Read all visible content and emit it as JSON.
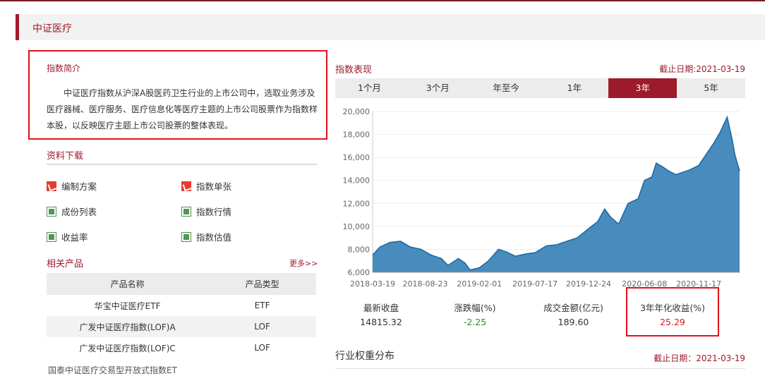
{
  "page_title": "中证医疗",
  "intro": {
    "heading": "指数简介",
    "text": "中证医疗指数从沪深A股医药卫生行业的上市公司中，选取业务涉及医疗器械、医疗服务、医疗信息化等医疗主题的上市公司股票作为指数样本股，以反映医疗主题上市公司股票的整体表现。"
  },
  "downloads": {
    "heading": "资料下载",
    "items": [
      {
        "label": "编制方案",
        "icon": "pdf-icon"
      },
      {
        "label": "指数单张",
        "icon": "pdf-icon"
      },
      {
        "label": "成份列表",
        "icon": "excel-icon"
      },
      {
        "label": "指数行情",
        "icon": "excel-icon"
      },
      {
        "label": "收益率",
        "icon": "excel-icon"
      },
      {
        "label": "指数估值",
        "icon": "excel-icon"
      }
    ]
  },
  "products": {
    "heading": "相关产品",
    "more": "更多>>",
    "columns": [
      "产品名称",
      "产品类型"
    ],
    "rows": [
      [
        "华宝中证医疗ETF",
        "ETF"
      ],
      [
        "广发中证医疗指数(LOF)A",
        "LOF"
      ],
      [
        "广发中证医疗指数(LOF)C",
        "LOF"
      ]
    ],
    "cut_row": "国泰中证医疗交易型开放式指数ET"
  },
  "performance": {
    "heading": "指数表现",
    "as_of": "截止日期:2021-03-19",
    "tabs": [
      "1个月",
      "3个月",
      "年至今",
      "1年",
      "3年",
      "5年"
    ],
    "active_tab": "3年",
    "stats": [
      {
        "label": "最新收盘",
        "value": "14815.32",
        "color": "#333333"
      },
      {
        "label": "涨跌幅(%)",
        "value": "-2.25",
        "color": "#2e8b2e"
      },
      {
        "label": "成交金额(亿元)",
        "value": "189.60",
        "color": "#333333"
      },
      {
        "label": "3年年化收益(%)",
        "value": "25.29",
        "color": "#e0121c"
      }
    ]
  },
  "weights": {
    "heading": "行业权重分布",
    "as_of": "截止日期：2021-03-19"
  },
  "colors": {
    "accent": "#9b1b2b",
    "area": "#3d86b8",
    "area_line": "#1f6aa5",
    "highlight": "#e0121c"
  },
  "chart_data": {
    "type": "area",
    "xlabel": "",
    "ylabel": "",
    "ylim": [
      6000,
      20000
    ],
    "yticks": [
      "6,000",
      "8,000",
      "10,000",
      "12,000",
      "14,000",
      "16,000",
      "18,000",
      "20,000"
    ],
    "xticks": [
      "2018-03-19",
      "2018-08-23",
      "2019-02-01",
      "2019-07-17",
      "2019-12-24",
      "2020-06-08",
      "2020-11-17"
    ],
    "x": [
      "2018-03-19",
      "2018-04-10",
      "2018-05-10",
      "2018-06-10",
      "2018-07-10",
      "2018-08-10",
      "2018-09-10",
      "2018-10-10",
      "2018-10-30",
      "2018-11-30",
      "2018-12-20",
      "2019-01-04",
      "2019-02-01",
      "2019-02-28",
      "2019-03-30",
      "2019-04-20",
      "2019-05-20",
      "2019-06-20",
      "2019-07-17",
      "2019-08-20",
      "2019-09-20",
      "2019-10-20",
      "2019-11-20",
      "2019-12-24",
      "2020-01-20",
      "2020-02-10",
      "2020-02-28",
      "2020-03-23",
      "2020-04-20",
      "2020-05-20",
      "2020-06-08",
      "2020-06-30",
      "2020-07-13",
      "2020-07-31",
      "2020-08-20",
      "2020-09-10",
      "2020-09-30",
      "2020-10-20",
      "2020-11-17",
      "2020-12-10",
      "2020-12-31",
      "2021-01-20",
      "2021-02-10",
      "2021-02-25",
      "2021-03-05",
      "2021-03-19"
    ],
    "series": [
      {
        "values": [
          7500,
          8200,
          8600,
          8700,
          8200,
          8000,
          7500,
          7200,
          6600,
          7200,
          6800,
          6200,
          6400,
          7000,
          8000,
          7800,
          7400,
          7600,
          7700,
          8300,
          8400,
          8700,
          9000,
          9800,
          10400,
          11500,
          10800,
          10200,
          12000,
          12400,
          14000,
          14300,
          15500,
          15200,
          14800,
          14500,
          14700,
          14900,
          15300,
          16300,
          17200,
          18200,
          19500,
          17500,
          16200,
          14815
        ]
      }
    ]
  }
}
